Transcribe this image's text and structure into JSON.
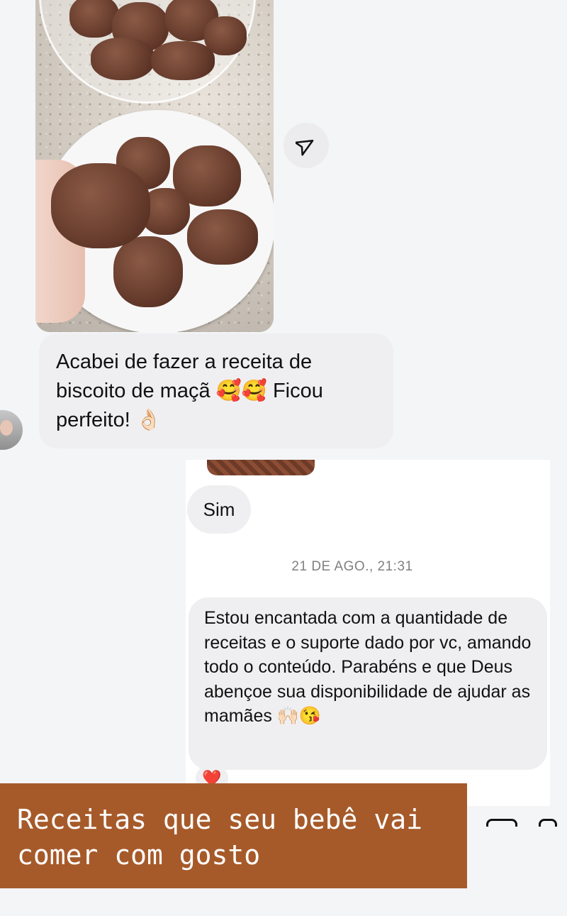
{
  "photo": {
    "description_icon": "share-icon"
  },
  "message_received": {
    "text": "Acabei de fazer a receita de biscoito de maçã 🥰🥰 Ficou perfeito! 👌🏻"
  },
  "screenshot": {
    "reply": "Sim",
    "timestamp": "21 DE AGO., 21:31",
    "message": "Estou encantada com a quantidade de receitas e o suporte dado por vc, amando todo o conteúdo. Parabéns e que Deus abençoe sua disponibilidade de ajudar as mamães 🙌🏻😘",
    "reaction": "❤️"
  },
  "banner": {
    "text": "Receitas que seu bebê vai\ncomer com gosto",
    "color": "#a65a2a"
  }
}
